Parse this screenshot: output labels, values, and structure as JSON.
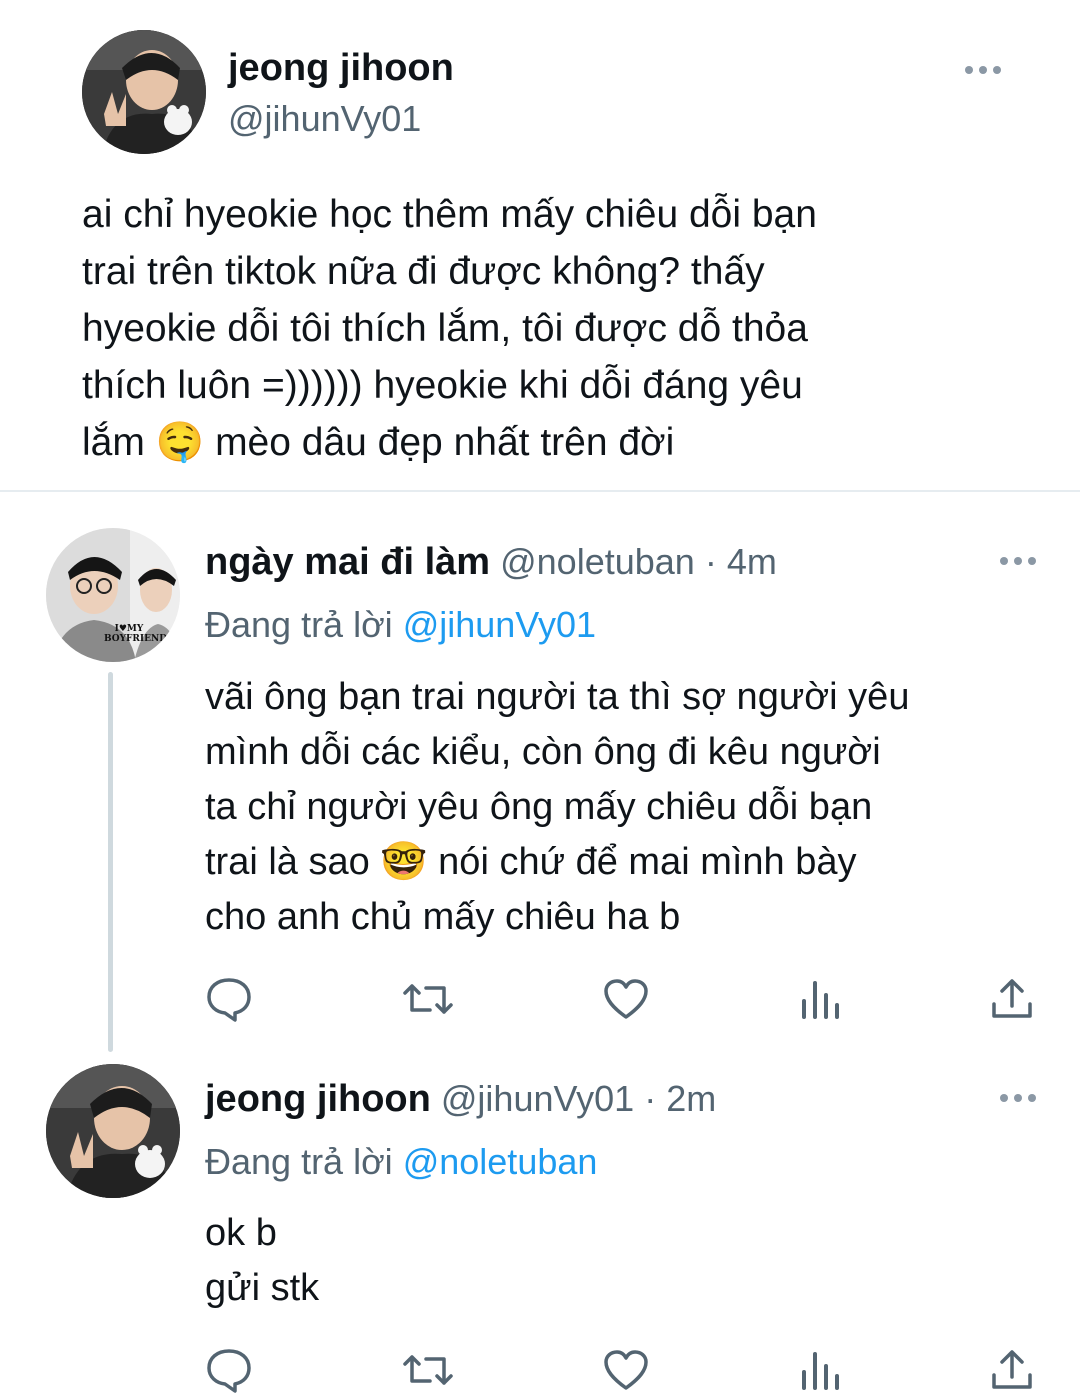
{
  "main_tweet": {
    "display_name": "jeong jihoon",
    "handle": "@jihunVy01",
    "text_lines": [
      "ai chỉ hyeokie học thêm mấy chiêu dỗi bạn",
      "trai trên tiktok nữa đi được không? thấy",
      "hyeokie dỗi tôi thích lắm, tôi được dỗ thỏa",
      "thích luôn =)))))) hyeokie khi dỗi đáng yêu",
      "lắm 🤤 mèo dâu đẹp nhất trên đời"
    ]
  },
  "reply1": {
    "display_name": "ngày mai đi làm",
    "handle": "@noletuban",
    "time": "· 4m",
    "reply_prefix": "Đang trả lời",
    "reply_to": "@jihunVy01",
    "avatar_caption": "I♥MY BOYFRIEND",
    "text_lines": [
      "vãi ông bạn trai người ta thì sợ người yêu",
      "mình dỗi các kiểu, còn ông đi kêu người",
      "ta chỉ người yêu ông mấy chiêu dỗi bạn",
      "trai là sao 🤓 nói chứ để mai mình bày",
      "cho anh chủ mấy chiêu ha b"
    ]
  },
  "reply2": {
    "display_name": "jeong jihoon",
    "handle": "@jihunVy01",
    "time": "· 2m",
    "reply_prefix": "Đang trả lời",
    "reply_to": "@noletuban",
    "text_lines": [
      "ok b",
      "gửi stk"
    ]
  },
  "icons": [
    "more-icon",
    "reply-icon",
    "retweet-icon",
    "like-icon",
    "views-icon",
    "share-icon"
  ],
  "colors": {
    "text": "#0f1419",
    "muted": "#536471",
    "link": "#1d9bf0",
    "divider": "#e6ecf0",
    "thread_line": "#cfd9de"
  }
}
